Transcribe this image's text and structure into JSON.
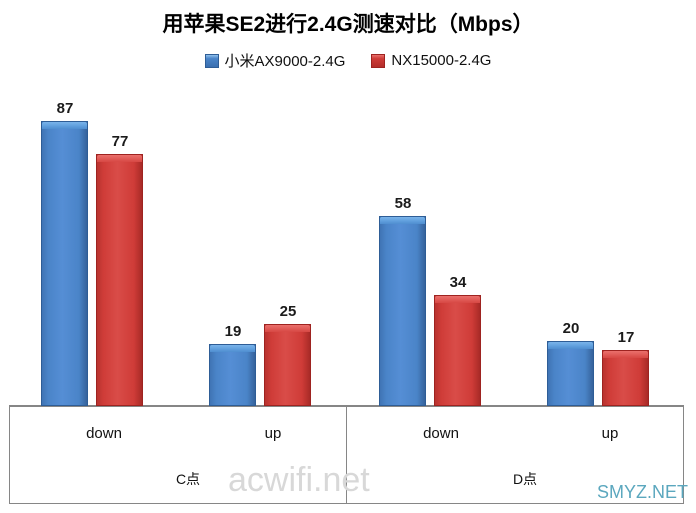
{
  "chart_data": {
    "type": "bar",
    "title": "用苹果SE2进行2.4G测速对比（Mbps）",
    "xlabel": "",
    "ylabel": "",
    "ylim": [
      0,
      95
    ],
    "grid": false,
    "legend_position": "top-center",
    "categories": [
      "down",
      "up",
      "down",
      "up"
    ],
    "group_labels": [
      "C点",
      "D点"
    ],
    "series": [
      {
        "name": "小米AX9000-2.4G",
        "color": "#4a84c8",
        "values": [
          87,
          19,
          58,
          20
        ]
      },
      {
        "name": "NX15000-2.4G",
        "color": "#cf3c38",
        "values": [
          77,
          25,
          34,
          17
        ]
      }
    ],
    "groups": [
      {
        "label": "C点",
        "categories": [
          {
            "name": "down",
            "blue": 87,
            "red": 77
          },
          {
            "name": "up",
            "blue": 19,
            "red": 25
          }
        ]
      },
      {
        "label": "D点",
        "categories": [
          {
            "name": "down",
            "blue": 58,
            "red": 34
          },
          {
            "name": "up",
            "blue": 20,
            "red": 17
          }
        ]
      }
    ],
    "data_labels": [
      "87",
      "77",
      "19",
      "25",
      "58",
      "34",
      "20",
      "17"
    ]
  },
  "legend": {
    "entries": [
      {
        "label": "小米AX9000-2.4G",
        "swatch": "blue-square-icon"
      },
      {
        "label": "NX15000-2.4G",
        "swatch": "red-square-icon"
      }
    ]
  },
  "axis": {
    "cat_labels": [
      "down",
      "up",
      "down",
      "up"
    ],
    "group_labels": [
      "C点",
      "D点"
    ]
  },
  "watermarks": {
    "primary": "acwifi.net",
    "secondary": "SMYZ.NET"
  },
  "colors": {
    "series_blue": "#4a84c8",
    "series_red": "#cf3c38",
    "axis_line": "#868686",
    "watermark_primary": "#d8d8d8",
    "watermark_secondary": "#5ba7be"
  }
}
